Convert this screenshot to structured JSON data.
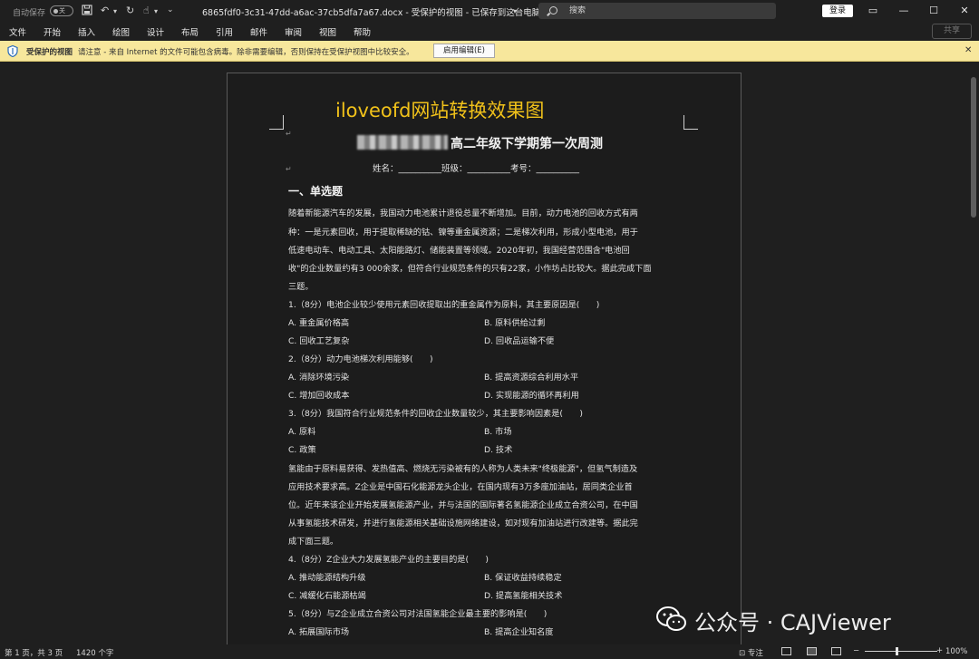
{
  "titlebar": {
    "autosave_label": "自动保存",
    "autosave_state": "关",
    "doc_title": "6865fdf0-3c31-47dd-a6ac-37cb5dfa7a67.docx  -  受保护的视图 - 已保存到这台电脑",
    "search_placeholder": "搜索",
    "login_label": "登录"
  },
  "menu": {
    "items": [
      "文件",
      "开始",
      "插入",
      "绘图",
      "设计",
      "布局",
      "引用",
      "邮件",
      "审阅",
      "视图",
      "帮助"
    ],
    "share_label": "共享"
  },
  "protected_bar": {
    "title": "受保护的视图",
    "message": "请注意 - 来自 Internet 的文件可能包含病毒。除非需要编辑，否则保持在受保护视图中比较安全。",
    "enable_button": "启用编辑(E)"
  },
  "document": {
    "watermark_title": "iloveofd网站转换效果图",
    "exam_title": "高二年级下学期第一次周测",
    "student_line": "姓名：__________班级：__________考号：__________",
    "section_heading": "一、单选题",
    "para1": [
      "随着新能源汽车的发展，我国动力电池累计退役总量不断增加。目前，动力电池的回收方式有两",
      "种：一是元素回收，用于提取稀缺的钴、镍等重金属资源；二是梯次利用，形成小型电池，用于",
      "低速电动车、电动工具、太阳能路灯、储能装置等领域。2020年初，我国经营范围含\"电池回",
      "收\"的企业数量约有3 000余家，但符合行业规范条件的只有22家，小作坊占比较大。据此完成下面",
      "三题。"
    ],
    "q1": "1.（8分）电池企业较少使用元素回收提取出的重金属作为原料，其主要原因是(　　)",
    "q1_options": [
      "A. 重金属价格高",
      "B. 原料供给过剩",
      "C. 回收工艺复杂",
      "D. 回收品运输不便"
    ],
    "q2": "2.（8分）动力电池梯次利用能够(　　)",
    "q2_options": [
      "A. 消除环境污染",
      "B. 提高资源综合利用水平",
      "C. 增加回收成本",
      "D. 实现能源的循环再利用"
    ],
    "q3": "3.（8分）我国符合行业规范条件的回收企业数量较少，其主要影响因素是(　　)",
    "q3_options": [
      "A. 原料",
      "B. 市场",
      "C. 政策",
      "D. 技术"
    ],
    "para2": [
      "氢能由于原料易获得、发热值高、燃烧无污染被有的人称为人类未来\"终极能源\"，但氢气制造及",
      "应用技术要求高。Z企业是中国石化能源龙头企业，在国内现有3万多座加油站，居同类企业首",
      "位。近年来该企业开始发展氢能源产业，并与法国的国际著名氢能源企业成立合资公司，在中国",
      "从事氢能技术研发，并进行氢能源相关基础设施网络建设，如对现有加油站进行改建等。据此完",
      "成下面三题。"
    ],
    "q4": "4.（8分）Z企业大力发展氢能产业的主要目的是(　　)",
    "q4_options": [
      "A. 推动能源结构升级",
      "B. 保证收益持续稳定",
      "C. 减缓化石能源枯竭",
      "D. 提高氢能相关技术"
    ],
    "q5": "5.（8分）与Z企业成立合资公司对法国氢能企业最主要的影响是(　　)",
    "q5_options": [
      "A. 拓展国际市场",
      "B. 提高企业知名度"
    ]
  },
  "status": {
    "page_info": "第 1 页，共 3 页",
    "word_count": "1420 个字",
    "focus_label": "专注",
    "zoom": "100%"
  },
  "overlay_watermark": "公众号 · CAJViewer",
  "colors": {
    "accent_yellow": "#f0c11a",
    "protected_bar": "#f7e79c",
    "background": "#1f1f1f"
  }
}
